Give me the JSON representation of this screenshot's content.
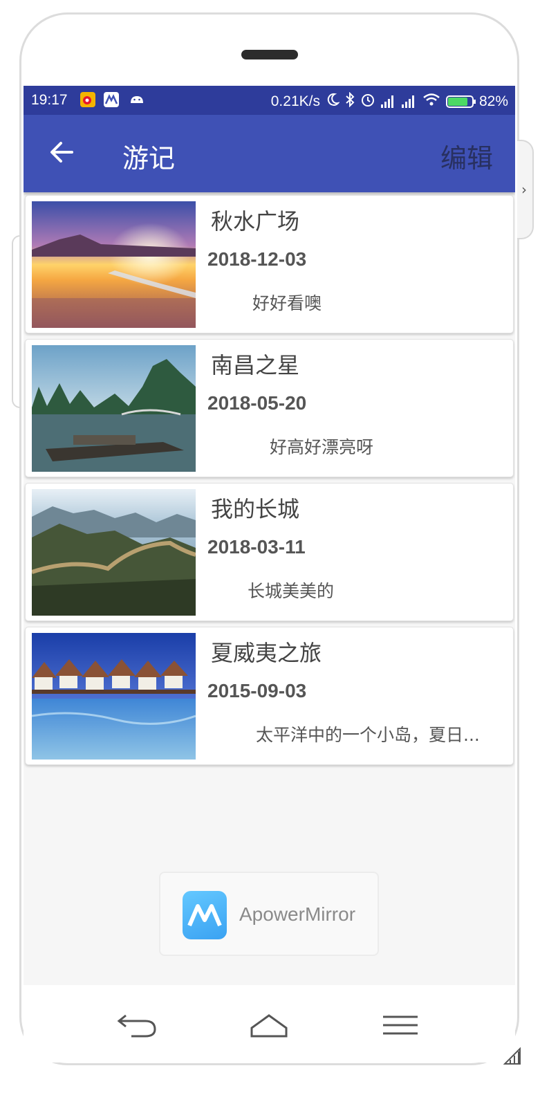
{
  "status_bar": {
    "time": "19:17",
    "network_speed": "0.21K/s",
    "battery_percent": "82%",
    "notification_icons": [
      "weibo-icon",
      "apowermirror-icon",
      "android-icon"
    ],
    "system_icons": [
      "moon-icon",
      "bluetooth-icon",
      "alarm-icon",
      "signal-icon",
      "signal-icon",
      "wifi-icon",
      "battery-charging-icon"
    ]
  },
  "app_bar": {
    "back_icon": "arrow-left-icon",
    "title": "游记",
    "edit_label": "编辑"
  },
  "entries": [
    {
      "title": "秋水广场",
      "date": "2018-12-03",
      "description": "好好看噢",
      "image": "sunset-lake-photo"
    },
    {
      "title": "南昌之星",
      "date": "2018-05-20",
      "description": "好高好漂亮呀",
      "image": "karst-mountains-river-photo"
    },
    {
      "title": "我的长城",
      "date": "2018-03-11",
      "description": "长城美美的",
      "image": "great-wall-photo"
    },
    {
      "title": "夏威夷之旅",
      "date": "2015-09-03",
      "description": "太平洋中的一个小岛，夏日...",
      "image": "tropical-huts-water-photo"
    }
  ],
  "watermark": {
    "text": "ApowerMirror",
    "logo_icon": "apowermirror-logo-icon"
  },
  "nav_bar": {
    "back_icon": "nav-back-icon",
    "home_icon": "nav-home-icon",
    "menu_icon": "nav-menu-icon"
  },
  "colors": {
    "status_bar": "#2e3c9b",
    "app_bar": "#3f51b5",
    "background": "#f6f6f6"
  }
}
